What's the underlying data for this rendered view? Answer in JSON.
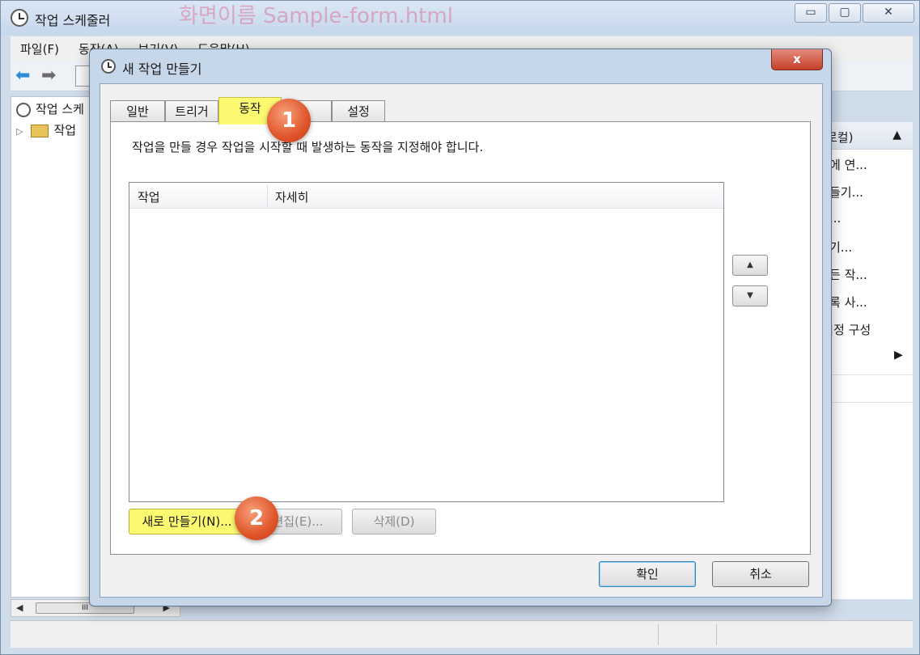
{
  "main_window": {
    "title": "작업 스케줄러",
    "watermark": "화면이름 Sample-form.html",
    "controls": {
      "minimize": "▭",
      "maximize": "▢",
      "close": "✕"
    },
    "menu": [
      "파일(F)",
      "동작(A)",
      "보기(V)",
      "도움말(H)"
    ],
    "tree": {
      "root": "작업 스케",
      "child": "작업"
    },
    "action_pane": {
      "header": "로컬)",
      "items": [
        "에 연...",
        "들기...",
        "...",
        "기...",
        "든 작...",
        "록 사...",
        "|정 구성"
      ]
    },
    "scrollbar_thumb": "III"
  },
  "dialog": {
    "title": "새 작업 만들기",
    "close_glyph": "x",
    "tabs": [
      "일반",
      "트리거",
      "동작",
      "조건",
      "설정"
    ],
    "active_tab": "동작",
    "description": "작업을 만들 경우 작업을 시작할 때 발생하는 동작을 지정해야 합니다.",
    "columns": [
      "작업",
      "자세히"
    ],
    "move_up": "▲",
    "move_down": "▼",
    "buttons": {
      "new": "새로 만들기(N)...",
      "edit": "편집(E)...",
      "delete": "삭제(D)"
    },
    "footer": {
      "ok": "확인",
      "cancel": "취소"
    }
  },
  "callouts": [
    "1",
    "2"
  ],
  "colors": {
    "highlight": "#fbf96f",
    "callout": "#e0552a",
    "dialog_frame": "#c7d7ea"
  }
}
